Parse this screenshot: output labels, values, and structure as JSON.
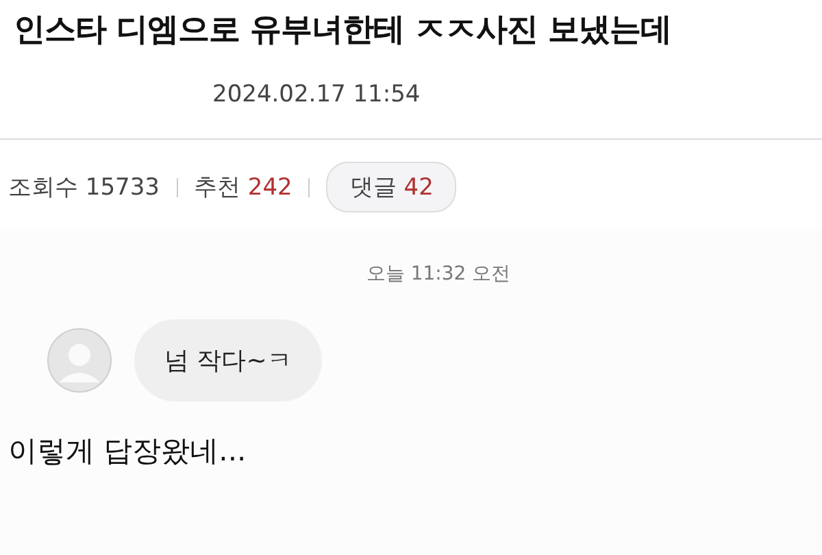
{
  "post": {
    "title": "인스타 디엠으로 유부녀한테 ㅈㅈ사진 보냈는데",
    "date": "2024.02.17 11:54"
  },
  "stats": [
    {
      "kind": "plain",
      "label": "조회수",
      "value": "15733"
    },
    {
      "kind": "highlight",
      "label": "추천",
      "value": "242"
    },
    {
      "kind": "pill",
      "label": "댓글",
      "value": "42"
    }
  ],
  "chat": {
    "time": "오늘 11:32 오전",
    "messages": [
      {
        "text": "넘 작다~ㅋ"
      }
    ]
  },
  "caption": "이렇게 답장왔네..."
}
